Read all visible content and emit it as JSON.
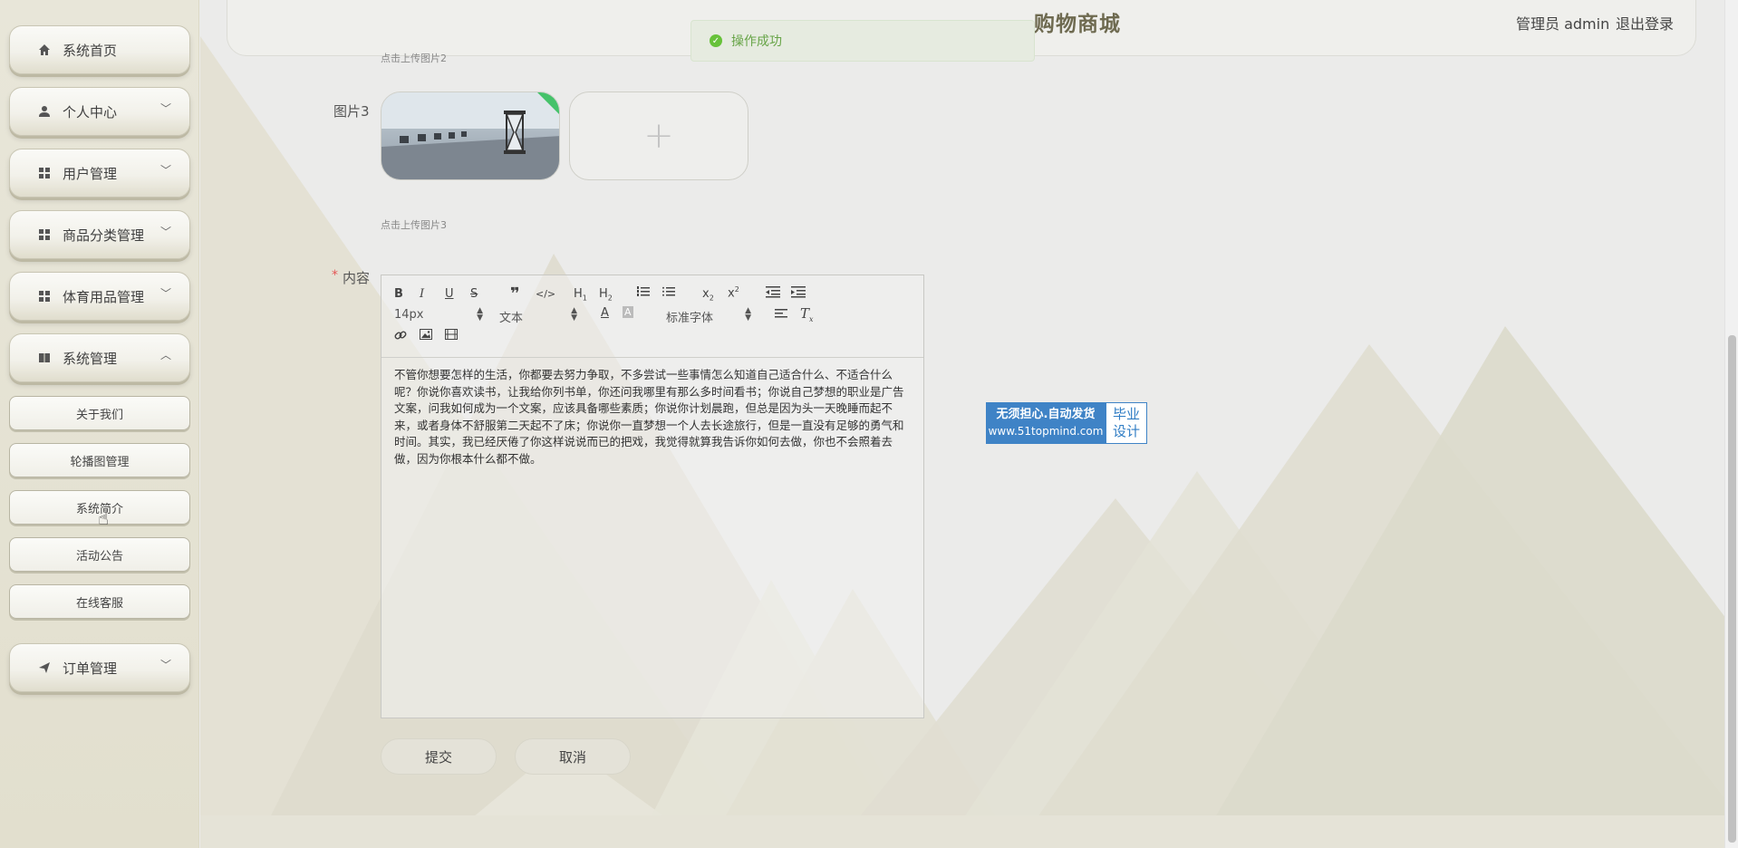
{
  "sidebar": {
    "menus": [
      {
        "label": "系统首页",
        "icon": "home-icon"
      },
      {
        "label": "个人中心",
        "icon": "user-icon",
        "chevron": "down"
      },
      {
        "label": "用户管理",
        "icon": "grid-icon",
        "chevron": "down"
      },
      {
        "label": "商品分类管理",
        "icon": "grid-icon",
        "chevron": "down"
      },
      {
        "label": "体育用品管理",
        "icon": "grid-icon",
        "chevron": "down"
      },
      {
        "label": "系统管理",
        "icon": "book-icon",
        "chevron": "up"
      }
    ],
    "submenus": [
      "关于我们",
      "轮播图管理",
      "系统简介",
      "活动公告",
      "在线客服"
    ],
    "order_menu": {
      "label": "订单管理",
      "icon": "send-icon",
      "chevron": "down"
    }
  },
  "header": {
    "title": "购物商城",
    "user": "管理员 admin",
    "logout": "退出登录"
  },
  "toast": {
    "message": "操作成功"
  },
  "form": {
    "hint_image2": "点击上传图片2",
    "image3_label": "图片3",
    "hint_image3": "点击上传图片3",
    "content_label": "内容",
    "required_mark": "*",
    "upload_plus": "+",
    "toolbar": {
      "font_size": "14px",
      "paragraph": "文本",
      "font_family": "标准字体"
    },
    "content_text": "不管你想要怎样的生活，你都要去努力争取，不多尝试一些事情怎么知道自己适合什么、不适合什么呢？你说你喜欢读书，让我给你列书单，你还问我哪里有那么多时间看书；你说自己梦想的职业是广告文案，问我如何成为一个文案，应该具备哪些素质；你说你计划晨跑，但总是因为头一天晚睡而起不来，或者身体不舒服第二天起不了床；你说你一直梦想一个人去长途旅行，但是一直没有足够的勇气和时间。其实，我已经厌倦了你这样说说而已的把戏，我觉得就算我告诉你如何去做，你也不会照着去做，因为你根本什么都不做。",
    "submit": "提交",
    "cancel": "取消"
  },
  "watermark": {
    "line1": "无须担心.自动发货",
    "line2": "www.51topmind.com",
    "right": "毕业设计"
  },
  "colors": {
    "accent_title": "#6e6a50",
    "toast_success": "#67c23a",
    "watermark_blue": "#3f83c6",
    "required_red": "#e45656"
  }
}
